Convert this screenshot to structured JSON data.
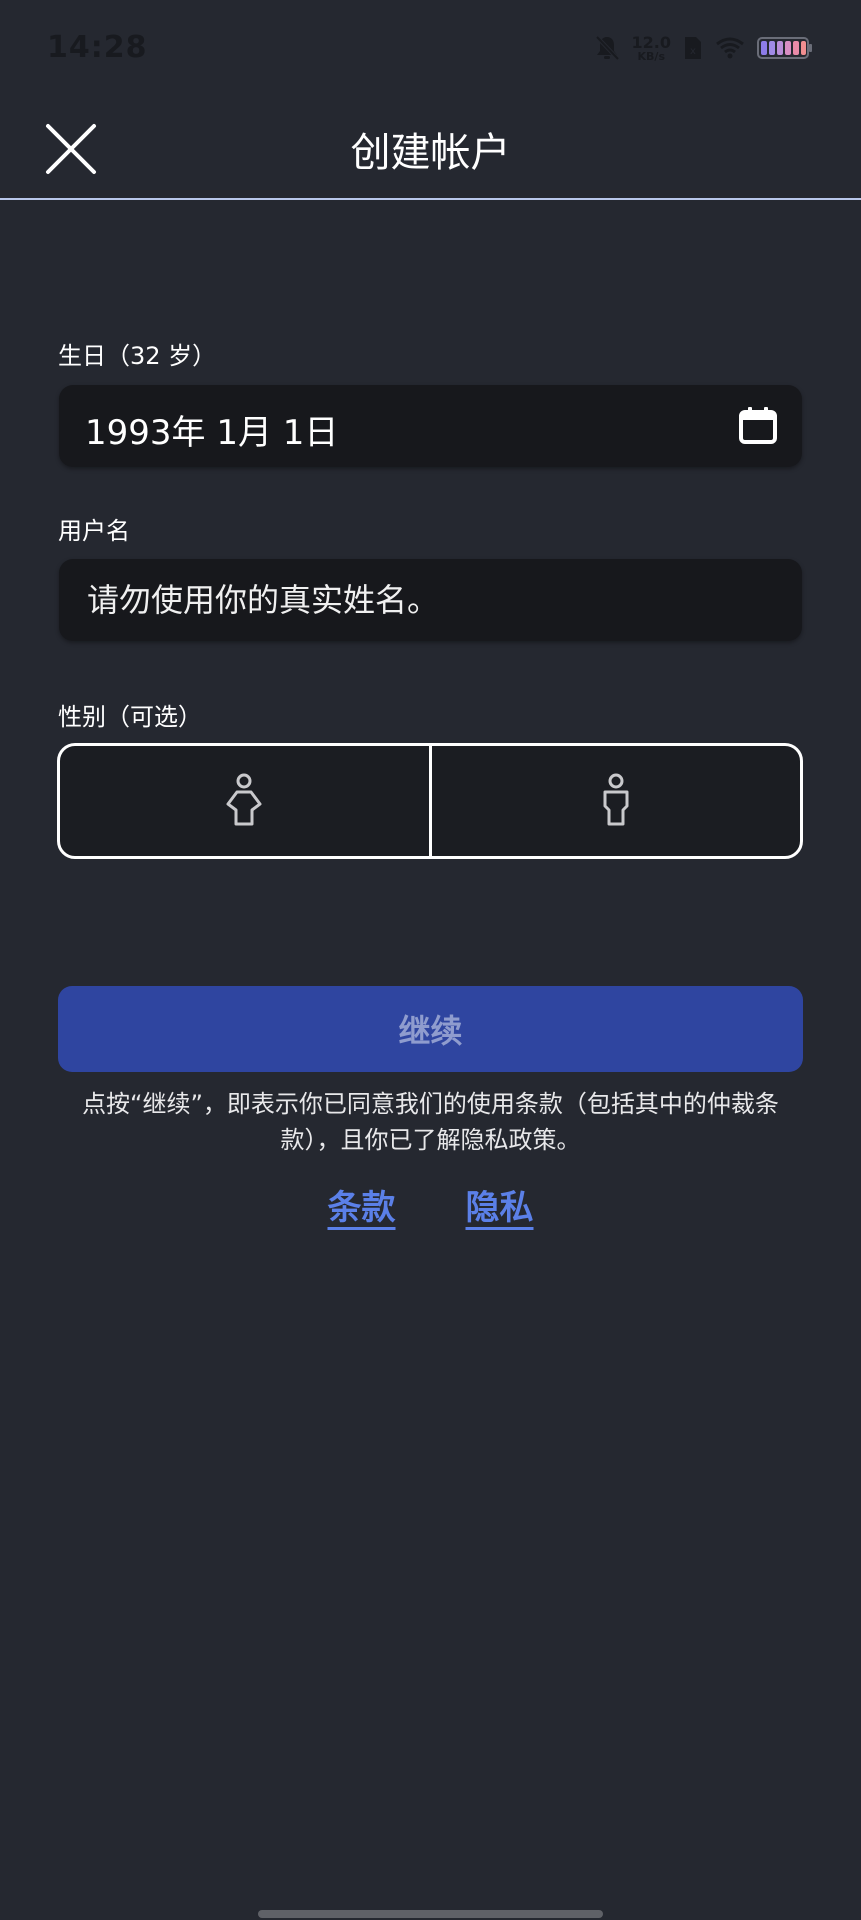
{
  "status_bar": {
    "time": "14:28",
    "net_speed_value": "12.0",
    "net_speed_unit": "KB/s",
    "icons": [
      "bell-muted-icon",
      "sim-icon",
      "wifi-icon",
      "battery-icon"
    ]
  },
  "header": {
    "title": "创建帐户",
    "close_icon": "close-icon"
  },
  "birthday": {
    "label": "生日（32 岁）",
    "value": "1993年 1月 1日",
    "icon": "calendar-icon"
  },
  "username": {
    "label": "用户名",
    "placeholder": "请勿使用你的真实姓名。",
    "value": ""
  },
  "gender": {
    "label": "性别（可选）",
    "options": [
      {
        "icon": "female-icon"
      },
      {
        "icon": "male-icon"
      }
    ]
  },
  "continue_button": {
    "label": "继续",
    "color": "#2f45a0"
  },
  "legal": {
    "text": "点按“继续”，即表示你已同意我们的使用条款（包括其中的仲裁条款），且你已了解隐私政策。",
    "terms_link": "条款",
    "privacy_link": "隐私",
    "link_color": "#5b80e8"
  }
}
